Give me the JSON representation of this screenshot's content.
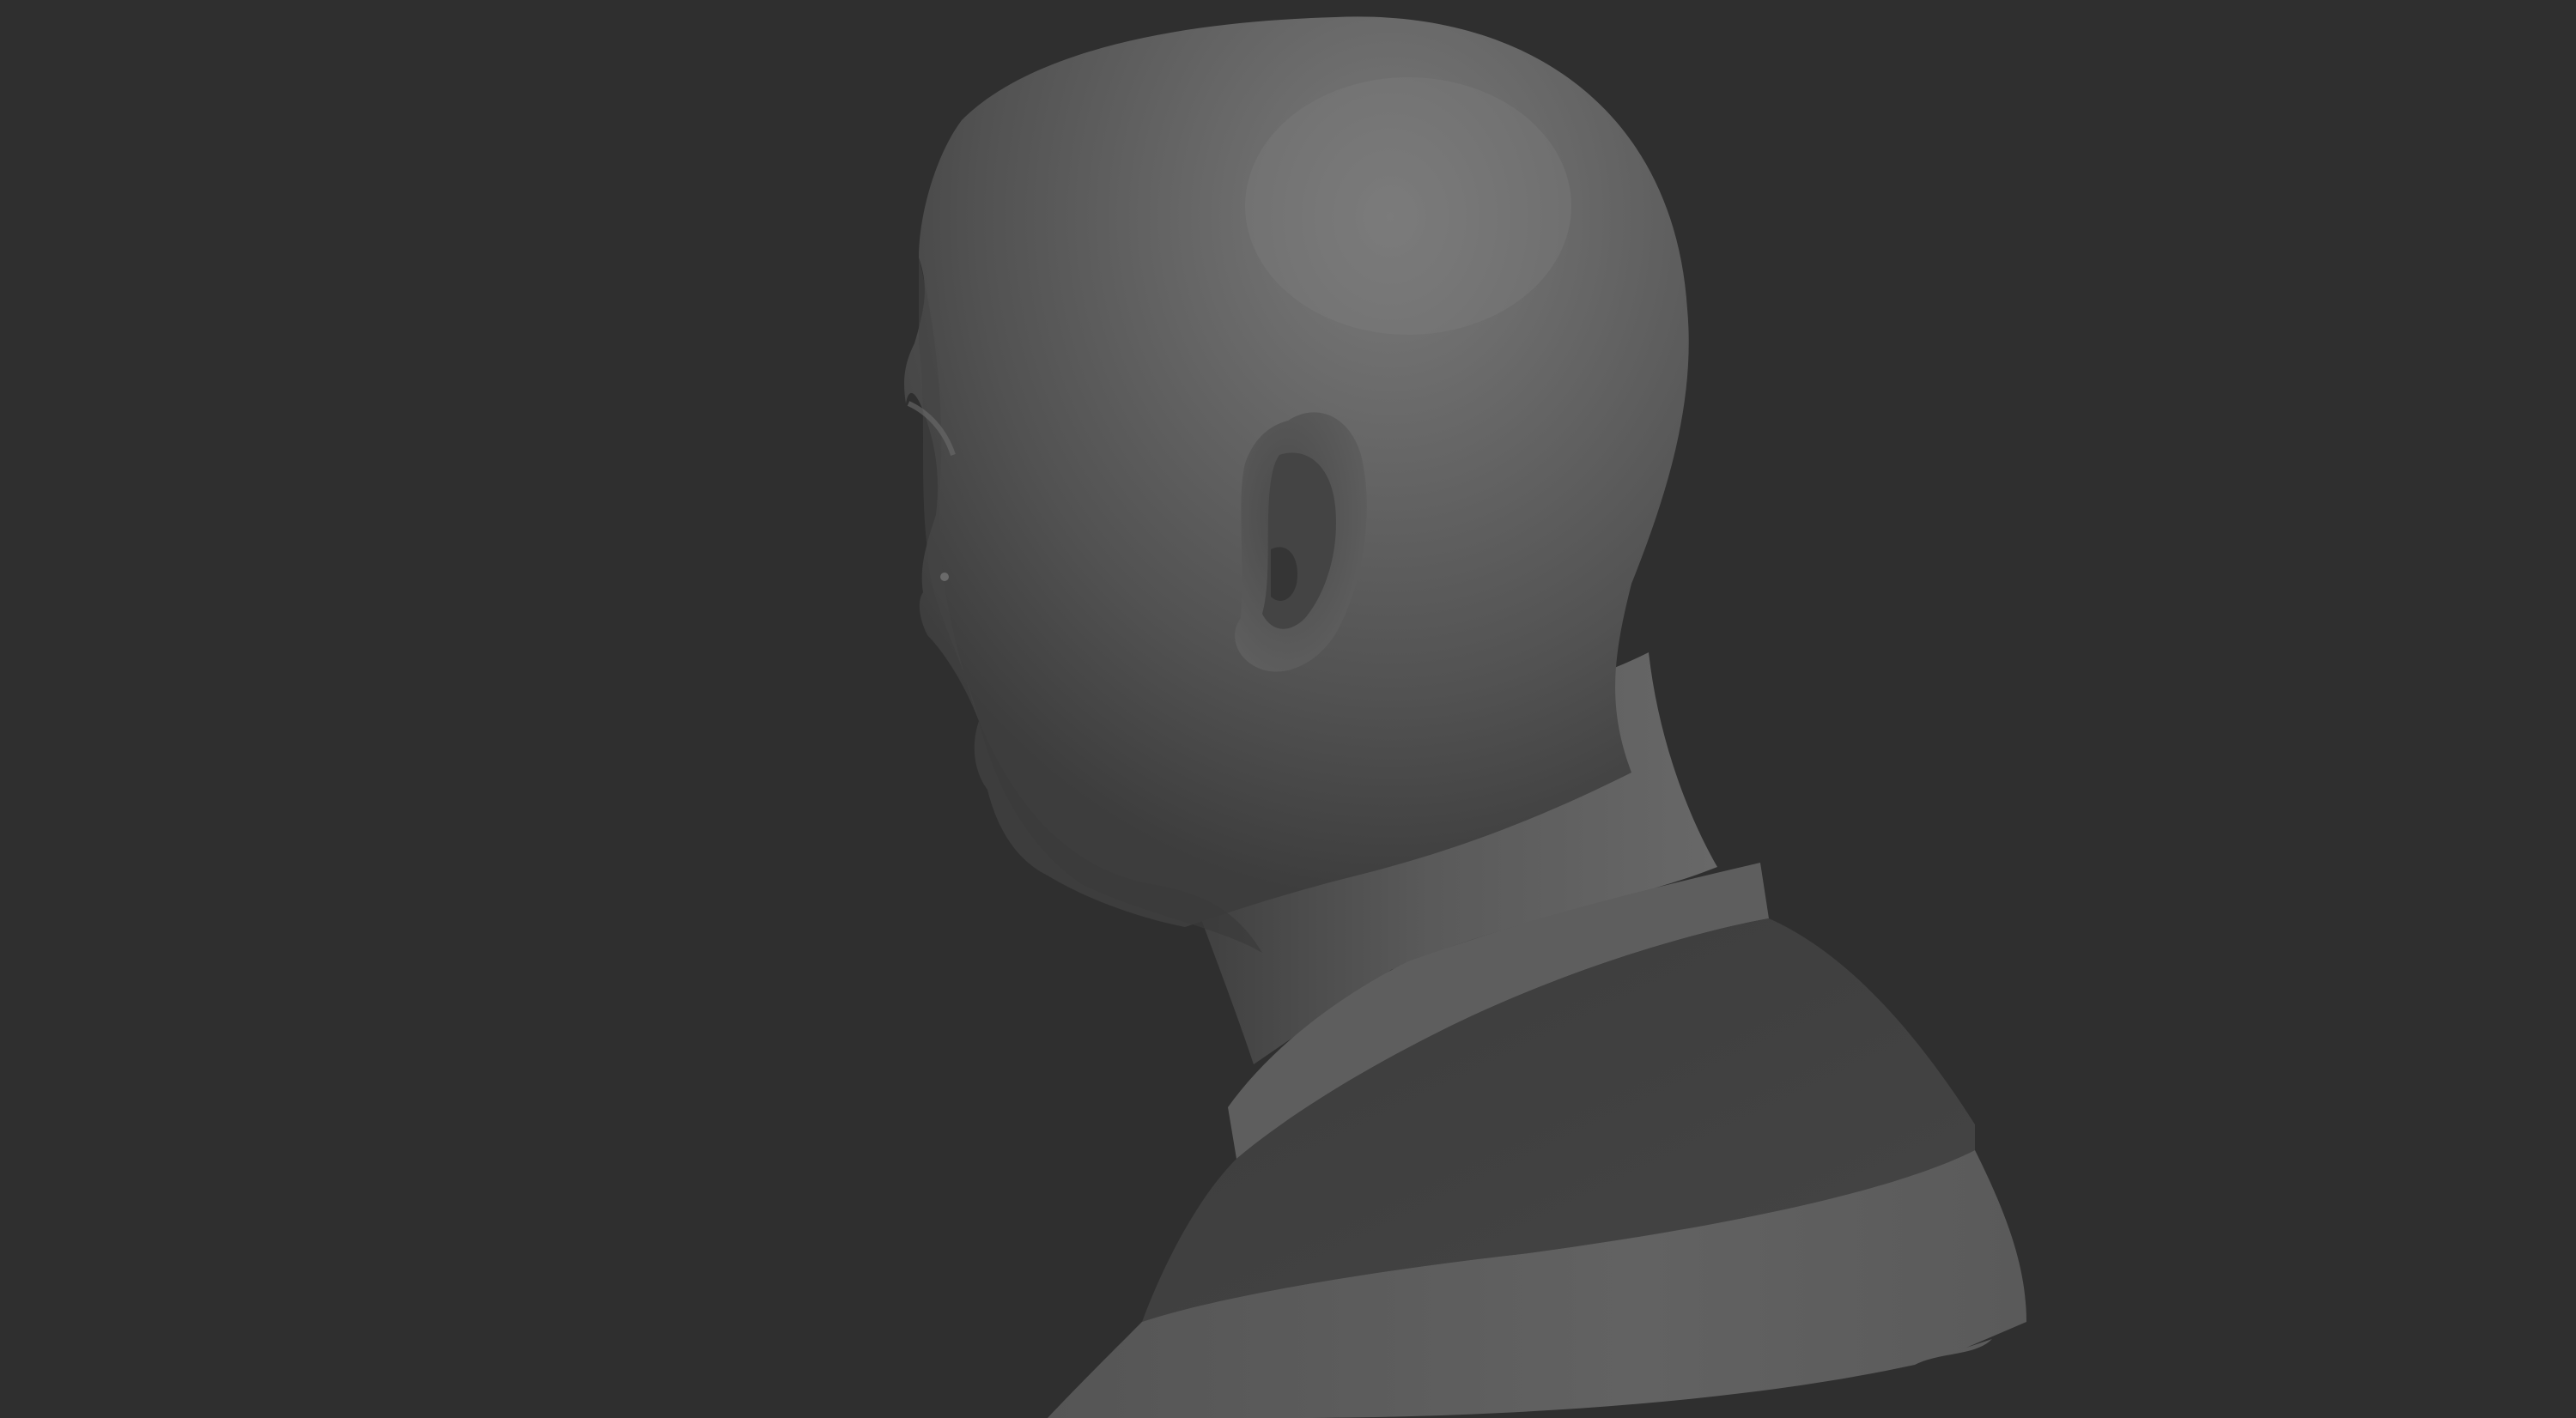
{
  "viewport": {
    "background_color": "#2f2f2f",
    "model": {
      "subject": "bust",
      "material_color": "#5c5c5c"
    }
  }
}
